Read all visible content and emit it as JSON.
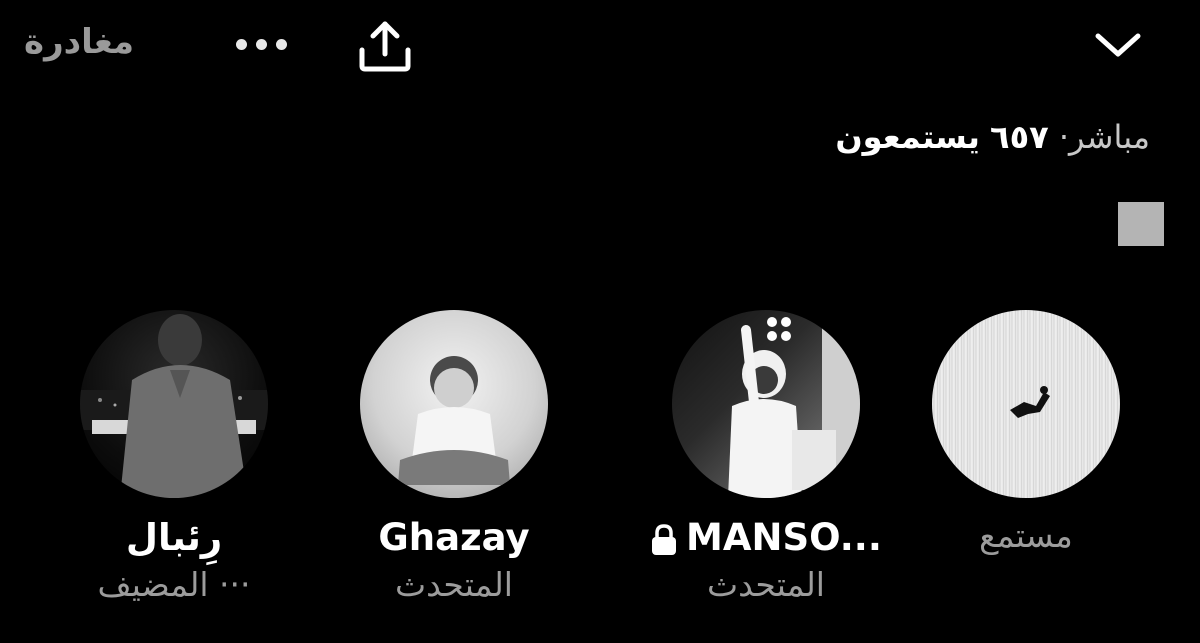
{
  "topbar": {
    "leave_label": "مغادرة",
    "more_icon": "ellipsis-icon",
    "share_icon": "share-icon",
    "collapse_icon": "chevron-down-icon"
  },
  "status": {
    "live_label": "مباشر·",
    "listeners_count": "٦٥٧",
    "listeners_label": "يستمعون"
  },
  "participants": [
    {
      "name": "رِئبال",
      "role": "··· المضيف"
    },
    {
      "name": "Ghazay",
      "role": "المتحدث"
    },
    {
      "name": "MANSO...",
      "role": "المتحدث",
      "locked": true
    },
    {
      "name": "",
      "role": "مستمع"
    }
  ],
  "colors": {
    "background": "#000000",
    "primary_text": "#ffffff",
    "secondary_text": "#9c9c9c"
  }
}
